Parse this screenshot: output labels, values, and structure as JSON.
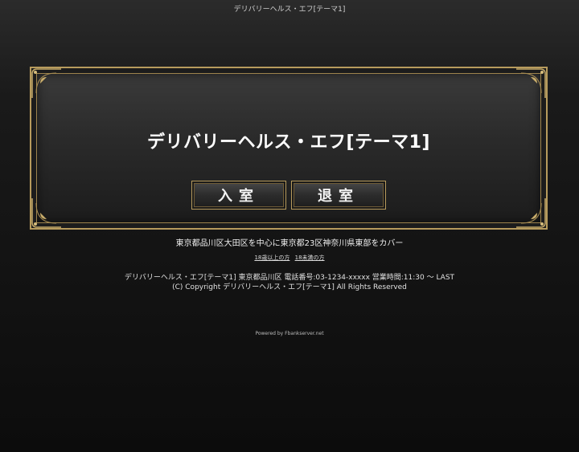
{
  "window": {
    "title": "デリバリーヘルス・エフ[テーマ1]"
  },
  "frame": {
    "shop_name": "デリバリーヘルス・エフ[テーマ1]",
    "enter_button": "入室",
    "exit_button": "退室"
  },
  "area_text": "東京都品川区大田区を中心に東京都23区神奈川県東部をカバー",
  "age_links": {
    "over18": "18歳以上の方",
    "under18": "18未満の方"
  },
  "footer": {
    "info": "デリバリーヘルス・エフ[テーマ1] 東京都品川区 電話番号:03-1234-xxxxx 営業時間:11:30 ～ LAST",
    "copyright": "(C) Copyright デリバリーヘルス・エフ[テーマ1] All Rights Reserved",
    "powered": "Powered by Fbankserver.net"
  },
  "colors": {
    "gold": "#b79b5d",
    "background": "#1a1a1a"
  },
  "icons": [
    "corner-ornament-icon"
  ]
}
